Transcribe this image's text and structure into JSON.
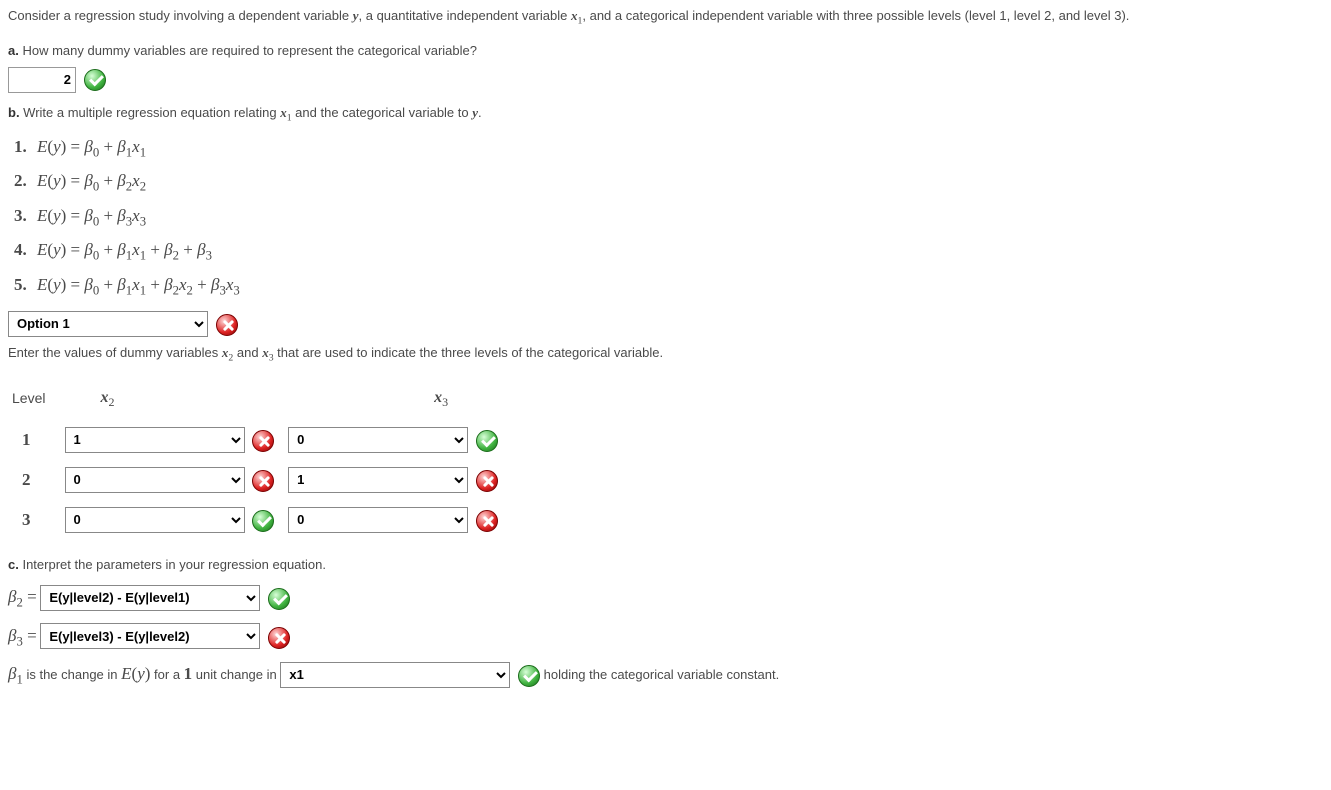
{
  "intro": "Consider a regression study involving a dependent variable y, a quantitative independent variable x₁, and a categorical independent variable with three possible levels (level 1, level 2, and level 3).",
  "partA": {
    "label": "a.",
    "text": "How many dummy variables are required to represent the categorical variable?",
    "value": "2",
    "feedback": "correct"
  },
  "partB": {
    "label": "b.",
    "text": "Write a multiple regression equation relating x₁ and the categorical variable to y.",
    "equations": [
      "E(y) = β₀ + β₁x₁",
      "E(y) = β₀ + β₂x₂",
      "E(y) = β₀ + β₃x₃",
      "E(y) = β₀ + β₁x₁ + β₂ + β₃",
      "E(y) = β₀ + β₁x₁ + β₂x₂ + β₃x₃"
    ],
    "selected": "Option 1",
    "feedback": "incorrect",
    "dummyText": "Enter the values of dummy variables x₂ and x₃ that are used to indicate the three levels of the categorical variable.",
    "table": {
      "headers": {
        "level": "Level",
        "x2": "x₂",
        "x3": "x₃"
      },
      "rows": [
        {
          "level": "1",
          "x2": "1",
          "x2fb": "incorrect",
          "x3": "0",
          "x3fb": "correct"
        },
        {
          "level": "2",
          "x2": "0",
          "x2fb": "incorrect",
          "x3": "1",
          "x3fb": "incorrect"
        },
        {
          "level": "3",
          "x2": "0",
          "x2fb": "correct",
          "x3": "0",
          "x3fb": "incorrect"
        }
      ]
    }
  },
  "partC": {
    "label": "c.",
    "text": "Interpret the parameters in your regression equation.",
    "beta2": {
      "selected": "E(y|level2) - E(y|level1)",
      "feedback": "correct"
    },
    "beta3": {
      "selected": "E(y|level3) - E(y|level2)",
      "feedback": "incorrect"
    },
    "beta1": {
      "prefix": "β₁ is the change in E(y) for a 1 unit change in",
      "selected": "x1",
      "feedback": "correct",
      "suffix": "holding the categorical variable constant."
    }
  }
}
